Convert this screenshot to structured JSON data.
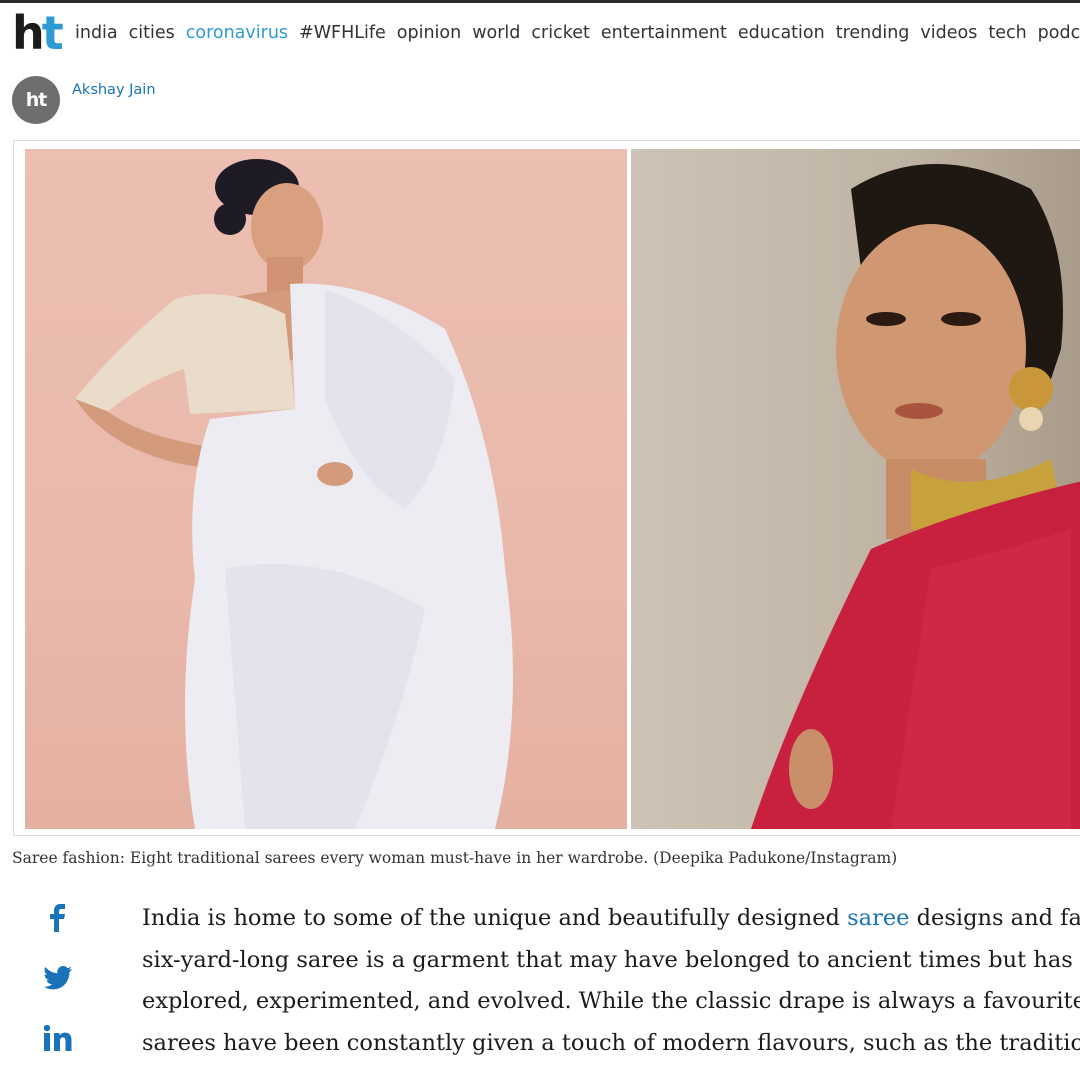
{
  "brand": {
    "logo_h": "h",
    "logo_t": "t",
    "accent": "#2e9bd6"
  },
  "nav": {
    "items": [
      "india",
      "cities",
      "coronavirus",
      "#WFHLife",
      "opinion",
      "world",
      "cricket",
      "entertainment",
      "education",
      "trending",
      "videos",
      "tech",
      "podcasts"
    ],
    "active": "coronavirus"
  },
  "author": {
    "avatar_text": "ht",
    "name": "Akshay Jain"
  },
  "media": {
    "left_image": "woman-in-white-saree-photo",
    "right_image": "woman-in-pink-saree-portrait-photo"
  },
  "caption": "Saree fashion: Eight traditional sarees every woman must-have in her wardrobe. (Deepika Padukone/Instagram)",
  "share": {
    "icons": [
      "facebook-icon",
      "twitter-icon",
      "linkedin-icon"
    ]
  },
  "article": {
    "line1_before": "India is home to some of the unique and beautifully designed ",
    "line1_link": "saree",
    "line1_after": " designs and fabrics. The",
    "line2": "six-yard-long saree is a garment that may have belonged to ancient times but has been",
    "line3": "explored, experimented, and evolved. While the classic drape is always a favourite,",
    "line4": "sarees have been constantly given a touch of modern flavours, such as the traditional"
  }
}
